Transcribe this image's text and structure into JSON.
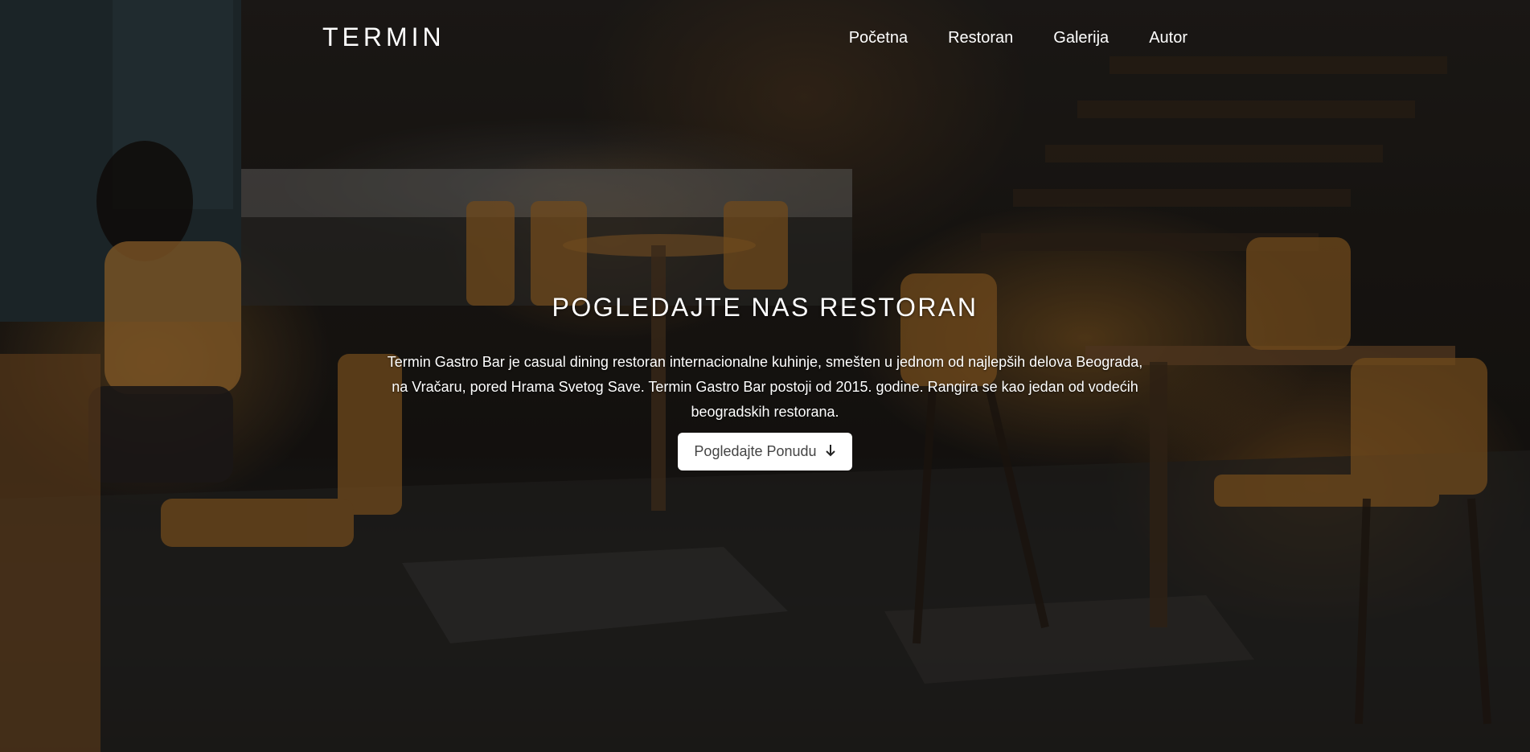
{
  "navbar": {
    "brand": "TERMIN",
    "links": [
      {
        "label": "Početna"
      },
      {
        "label": "Restoran"
      },
      {
        "label": "Galerija"
      },
      {
        "label": "Autor"
      }
    ]
  },
  "hero": {
    "title": "POGLEDAJTE NAS RESTORAN",
    "description": "Termin Gastro Bar je casual dining restoran internacionalne kuhinje, smešten u jednom od najlepših delova Beograda, na Vračaru, pored Hrama Svetog Save. Termin Gastro Bar postoji od 2015. godine. Rangira se kao jedan od vodećih beogradskih restorana.",
    "button_label": "Pogledajte Ponudu",
    "button_icon": "arrow-down-icon"
  },
  "colors": {
    "text": "#ffffff",
    "button_bg": "#ffffff",
    "button_text": "#444444",
    "accent_wood": "#c8842d"
  }
}
